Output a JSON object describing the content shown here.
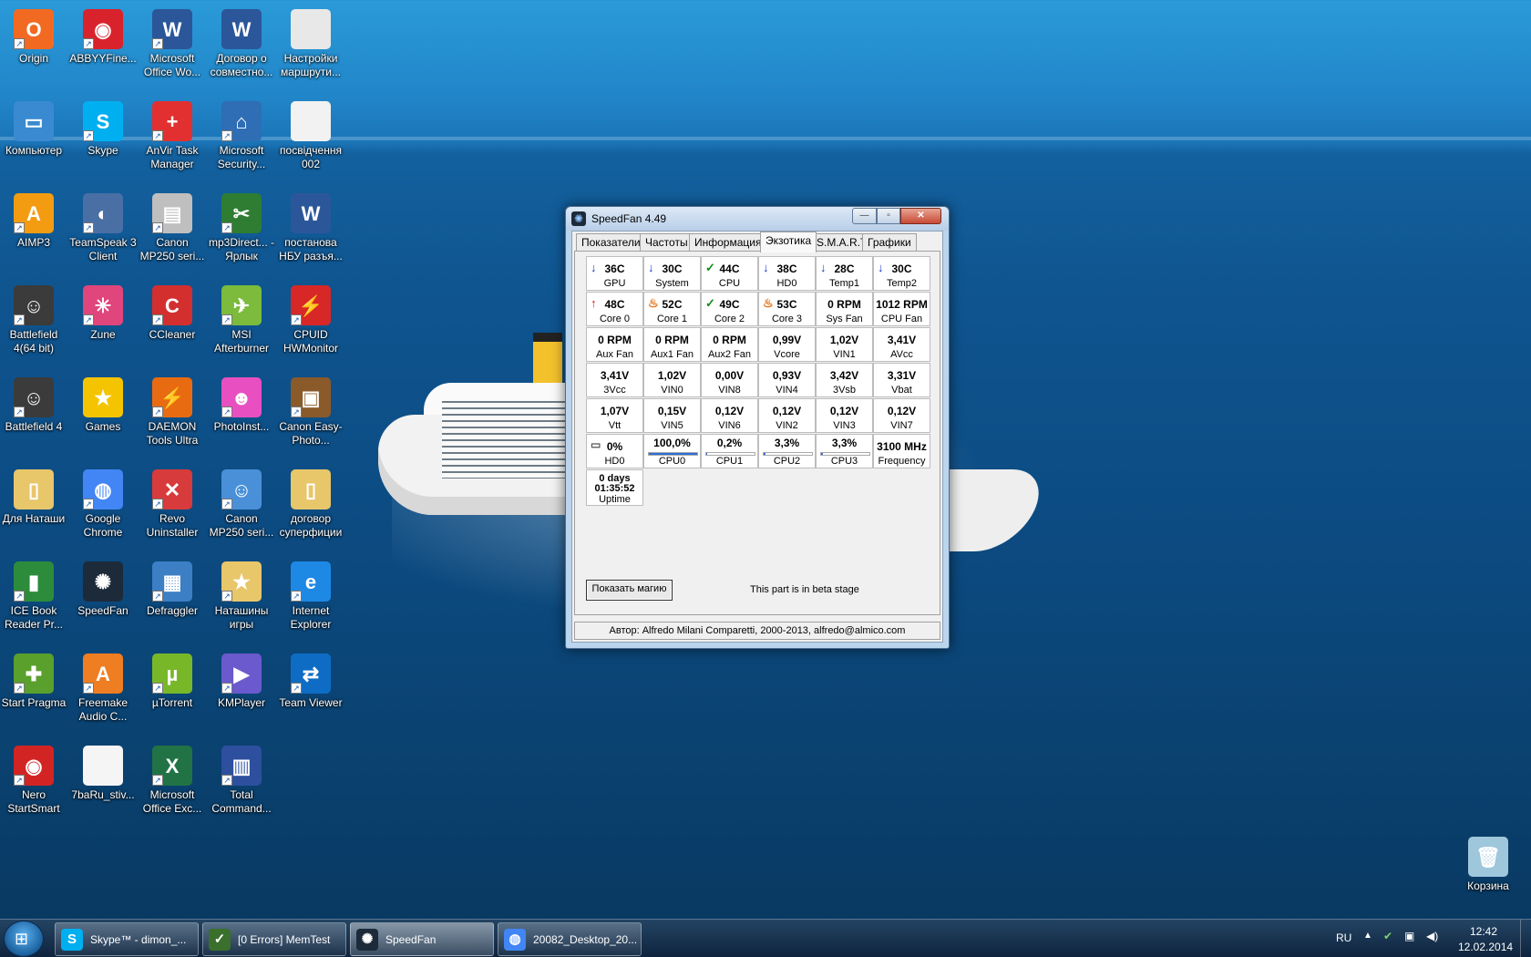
{
  "desktop": {
    "icons": [
      {
        "label": "Origin",
        "color": "#f26a21",
        "glyph": "O",
        "shortcut": true
      },
      {
        "label": "ABBYYFine...",
        "color": "#d9232c",
        "glyph": "◉",
        "shortcut": true
      },
      {
        "label": "Microsoft Office Wo...",
        "color": "#2b579a",
        "glyph": "W",
        "shortcut": true
      },
      {
        "label": "Договор о совместно...",
        "color": "#2b579a",
        "glyph": "W",
        "shortcut": false
      },
      {
        "label": "Настройки маршрути...",
        "color": "#e8e8e8",
        "glyph": "",
        "shortcut": false
      },
      {
        "label": "Компьютер",
        "color": "#3a8ad1",
        "glyph": "▭",
        "shortcut": false
      },
      {
        "label": "Skype",
        "color": "#00aff0",
        "glyph": "S",
        "shortcut": true
      },
      {
        "label": "AnVir Task Manager",
        "color": "#e23030",
        "glyph": "+",
        "shortcut": true
      },
      {
        "label": "Microsoft Security...",
        "color": "#2f6db5",
        "glyph": "⌂",
        "shortcut": true
      },
      {
        "label": "посвідчення 002",
        "color": "#f2f2f2",
        "glyph": "",
        "shortcut": false
      },
      {
        "label": "AIMP3",
        "color": "#f39c12",
        "glyph": "A",
        "shortcut": true
      },
      {
        "label": "TeamSpeak 3 Client",
        "color": "#4a6fa5",
        "glyph": "◐",
        "shortcut": true
      },
      {
        "label": "Canon MP250 seri...",
        "color": "#bfbfbf",
        "glyph": "▤",
        "shortcut": true
      },
      {
        "label": "mp3Direct... - Ярлык",
        "color": "#2e7d32",
        "glyph": "✂",
        "shortcut": true
      },
      {
        "label": "постанова НБУ разъя...",
        "color": "#2b579a",
        "glyph": "W",
        "shortcut": false
      },
      {
        "label": "Battlefield 4(64 bit)",
        "color": "#3b3b3b",
        "glyph": "☺",
        "shortcut": true
      },
      {
        "label": "Zune",
        "color": "#e0457b",
        "glyph": "✳",
        "shortcut": true
      },
      {
        "label": "CCleaner",
        "color": "#d32f2f",
        "glyph": "C",
        "shortcut": true
      },
      {
        "label": "MSI Afterburner",
        "color": "#7cbb3c",
        "glyph": "✈",
        "shortcut": true
      },
      {
        "label": "CPUID HWMonitor",
        "color": "#d82727",
        "glyph": "⚡",
        "shortcut": true
      },
      {
        "label": "Battlefield 4",
        "color": "#3b3b3b",
        "glyph": "☺",
        "shortcut": true
      },
      {
        "label": "Games",
        "color": "#f5c400",
        "glyph": "★",
        "shortcut": false
      },
      {
        "label": "DAEMON Tools Ultra",
        "color": "#e86b12",
        "glyph": "⚡",
        "shortcut": true
      },
      {
        "label": "PhotoInst...",
        "color": "#e84fc0",
        "glyph": "☻",
        "shortcut": true
      },
      {
        "label": "Canon Easy-Photo...",
        "color": "#8a5a2b",
        "glyph": "▣",
        "shortcut": true
      },
      {
        "label": "Для Наташи",
        "color": "#e8c66a",
        "glyph": "▯",
        "shortcut": false
      },
      {
        "label": "Google Chrome",
        "color": "#4285f4",
        "glyph": "◍",
        "shortcut": true
      },
      {
        "label": "Revo Uninstaller",
        "color": "#d83b3b",
        "glyph": "✕",
        "shortcut": true
      },
      {
        "label": "Canon MP250 seri...",
        "color": "#4a90d9",
        "glyph": "☺",
        "shortcut": true
      },
      {
        "label": "договор суперфиции",
        "color": "#e8c66a",
        "glyph": "▯",
        "shortcut": false
      },
      {
        "label": "ICE Book Reader Pr...",
        "color": "#2c8c3c",
        "glyph": "▮",
        "shortcut": true
      },
      {
        "label": "SpeedFan",
        "color": "#1d2a3a",
        "glyph": "✺",
        "shortcut": false
      },
      {
        "label": "Defraggler",
        "color": "#3c7fc4",
        "glyph": "▦",
        "shortcut": true
      },
      {
        "label": "Наташины игры",
        "color": "#e8c66a",
        "glyph": "★",
        "shortcut": true
      },
      {
        "label": "Internet Explorer",
        "color": "#1e88e5",
        "glyph": "e",
        "shortcut": true
      },
      {
        "label": "Start Pragma",
        "color": "#5aa02c",
        "glyph": "✚",
        "shortcut": true
      },
      {
        "label": "Freemake Audio C...",
        "color": "#ef7d22",
        "glyph": "A",
        "shortcut": true
      },
      {
        "label": "µTorrent",
        "color": "#78b828",
        "glyph": "µ",
        "shortcut": true
      },
      {
        "label": "KMPlayer",
        "color": "#6a5acd",
        "glyph": "▶",
        "shortcut": true
      },
      {
        "label": "Team Viewer",
        "color": "#0e6cc4",
        "glyph": "⇄",
        "shortcut": true
      },
      {
        "label": "Nero StartSmart",
        "color": "#d32424",
        "glyph": "◉",
        "shortcut": true
      },
      {
        "label": "7baRu_stiv...",
        "color": "#f5f5f5",
        "glyph": "",
        "shortcut": false
      },
      {
        "label": "Microsoft Office Exc...",
        "color": "#217346",
        "glyph": "X",
        "shortcut": true
      },
      {
        "label": "Total Command...",
        "color": "#2d4f9e",
        "glyph": "▥",
        "shortcut": true
      },
      {
        "label": "Корзина",
        "color": "#9fc7dc",
        "glyph": "🗑",
        "shortcut": false
      }
    ]
  },
  "window": {
    "title": "SpeedFan 4.49",
    "tabs": [
      "Показатели",
      "Частоты",
      "Информация",
      "Экзотика",
      "S.M.A.R.T.",
      "Графики"
    ],
    "active_tab": "Экзотика",
    "cells": [
      {
        "value": "36C",
        "name": "GPU",
        "mark": "down"
      },
      {
        "value": "30C",
        "name": "System",
        "mark": "down"
      },
      {
        "value": "44C",
        "name": "CPU",
        "mark": "ok"
      },
      {
        "value": "38C",
        "name": "HD0",
        "mark": "down"
      },
      {
        "value": "28C",
        "name": "Temp1",
        "mark": "down"
      },
      {
        "value": "30C",
        "name": "Temp2",
        "mark": "down"
      },
      {
        "value": "48C",
        "name": "Core 0",
        "mark": "up"
      },
      {
        "value": "52C",
        "name": "Core 1",
        "mark": "fire"
      },
      {
        "value": "49C",
        "name": "Core 2",
        "mark": "ok"
      },
      {
        "value": "53C",
        "name": "Core 3",
        "mark": "fire"
      },
      {
        "value": "0 RPM",
        "name": "Sys Fan",
        "mark": ""
      },
      {
        "value": "1012 RPM",
        "name": "CPU Fan",
        "mark": ""
      },
      {
        "value": "0 RPM",
        "name": "Aux Fan",
        "mark": ""
      },
      {
        "value": "0 RPM",
        "name": "Aux1 Fan",
        "mark": ""
      },
      {
        "value": "0 RPM",
        "name": "Aux2 Fan",
        "mark": ""
      },
      {
        "value": "0,99V",
        "name": "Vcore",
        "mark": ""
      },
      {
        "value": "1,02V",
        "name": "VIN1",
        "mark": ""
      },
      {
        "value": "3,41V",
        "name": "AVcc",
        "mark": ""
      },
      {
        "value": "3,41V",
        "name": "3Vcc",
        "mark": ""
      },
      {
        "value": "1,02V",
        "name": "VIN0",
        "mark": ""
      },
      {
        "value": "0,00V",
        "name": "VIN8",
        "mark": ""
      },
      {
        "value": "0,93V",
        "name": "VIN4",
        "mark": ""
      },
      {
        "value": "3,42V",
        "name": "3Vsb",
        "mark": ""
      },
      {
        "value": "3,31V",
        "name": "Vbat",
        "mark": ""
      },
      {
        "value": "1,07V",
        "name": "Vtt",
        "mark": ""
      },
      {
        "value": "0,15V",
        "name": "VIN5",
        "mark": ""
      },
      {
        "value": "0,12V",
        "name": "VIN6",
        "mark": ""
      },
      {
        "value": "0,12V",
        "name": "VIN2",
        "mark": ""
      },
      {
        "value": "0,12V",
        "name": "VIN3",
        "mark": ""
      },
      {
        "value": "0,12V",
        "name": "VIN7",
        "mark": ""
      },
      {
        "value": "0%",
        "name": "HD0",
        "mark": "disk"
      },
      {
        "value": "100,0%",
        "name": "CPU0",
        "bar": 1.0
      },
      {
        "value": "0,2%",
        "name": "CPU1",
        "bar": 0.002
      },
      {
        "value": "3,3%",
        "name": "CPU2",
        "bar": 0.033
      },
      {
        "value": "3,3%",
        "name": "CPU3",
        "bar": 0.033
      },
      {
        "value": "3100 MHz",
        "name": "Frequency",
        "mark": ""
      }
    ],
    "uptime": {
      "days": "0 days",
      "time": "01:35:52",
      "name": "Uptime"
    },
    "magic_button": "Показать магию",
    "beta_note": "This part is in beta stage",
    "status": "Автор: Alfredo Milani Comparetti, 2000-2013, alfredo@almico.com"
  },
  "taskbar": {
    "items": [
      {
        "label": "Skype™ - dimon_...",
        "color": "#00aff0",
        "glyph": "S",
        "active": false
      },
      {
        "label": "[0 Errors] MemTest",
        "color": "#3a6f2c",
        "glyph": "✓",
        "active": false
      },
      {
        "label": "SpeedFan",
        "color": "#1d2a3a",
        "glyph": "✺",
        "active": true
      },
      {
        "label": "20082_Desktop_20...",
        "color": "#4285f4",
        "glyph": "◍",
        "active": false
      }
    ],
    "lang": "RU",
    "time": "12:42",
    "date": "12.02.2014"
  }
}
